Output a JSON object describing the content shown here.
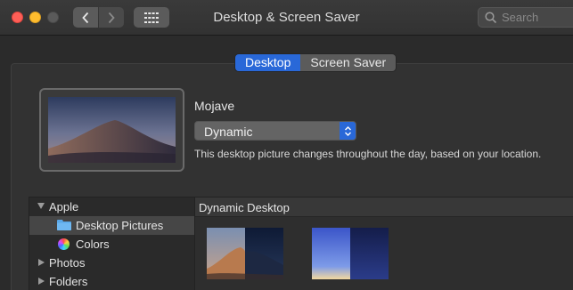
{
  "window": {
    "title": "Desktop & Screen Saver",
    "search_placeholder": "Search"
  },
  "tabs": [
    {
      "label": "Desktop",
      "active": true
    },
    {
      "label": "Screen Saver",
      "active": false
    }
  ],
  "wallpaper": {
    "name": "Mojave",
    "mode": "Dynamic",
    "description": "This desktop picture changes throughout the day, based on your location."
  },
  "sources": [
    {
      "label": "Apple",
      "expanded": true,
      "icon": "disclosure-triangle"
    },
    {
      "label": "Desktop Pictures",
      "selected": true,
      "icon": "folder-icon"
    },
    {
      "label": "Colors",
      "icon": "color-wheel-icon"
    },
    {
      "label": "Photos",
      "expanded": false,
      "icon": "disclosure-triangle"
    },
    {
      "label": "Folders",
      "expanded": false,
      "icon": "disclosure-triangle"
    }
  ],
  "dynamic_desktop": {
    "title": "Dynamic Desktop"
  },
  "colors": {
    "accent": "#2968d8",
    "close": "#fe5f57",
    "minimize": "#febc2e"
  }
}
